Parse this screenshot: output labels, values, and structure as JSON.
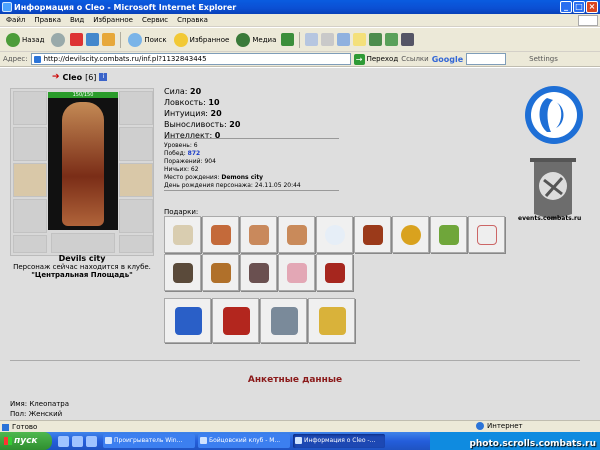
{
  "window": {
    "title": "Информация о Cleo - Microsoft Internet Explorer"
  },
  "menu": [
    "Файл",
    "Правка",
    "Вид",
    "Избранное",
    "Сервис",
    "Справка"
  ],
  "toolbar": {
    "back": "Назад",
    "search": "Поиск",
    "favorites": "Избранное",
    "media": "Медиа"
  },
  "address": {
    "label": "Адрес:",
    "url": "http://devilscity.combats.ru/inf.pl?1132843445",
    "go": "Переход",
    "links": "Ссылки",
    "google": "Google",
    "settings": "Settings"
  },
  "character": {
    "name": "Cleo",
    "level_tag": "[6]",
    "hp": "150/150",
    "clan_city": "Devils city",
    "location_text": "Персонаж сейчас находится в клубе.",
    "location_place": "\"Центральная Площадь\""
  },
  "stats": [
    {
      "label": "Сила:",
      "value": "20"
    },
    {
      "label": "Ловкость:",
      "value": "10"
    },
    {
      "label": "Интуиция:",
      "value": "20"
    },
    {
      "label": "Выносливость:",
      "value": "20"
    },
    {
      "label": "Интеллект:",
      "value": "0"
    }
  ],
  "info": [
    {
      "label": "Уровень:",
      "value": "6"
    },
    {
      "label": "Побед:",
      "value": "872"
    },
    {
      "label": "Поражений:",
      "value": "904"
    },
    {
      "label": "Ничьих:",
      "value": "62"
    },
    {
      "label": "Место рождения:",
      "value": "Demons city"
    },
    {
      "label": "День рождения персонажа:",
      "value": "24.11.05 20:44"
    }
  ],
  "gifts": {
    "label": "Подарки:",
    "row1": [
      "gift-rattle",
      "gift-bear-santa",
      "gift-bear",
      "gift-bear-2",
      "gift-snowflake",
      "gift-rocking-horse",
      "gift-gold-coin",
      "gift-goblin",
      "gift-white-rabbit"
    ],
    "row2": [
      "gift-helmet",
      "gift-broom",
      "gift-dark-creature",
      "gift-pig-wings",
      "gift-present-box"
    ],
    "row3": [
      "gift-tree-card",
      "gift-photo-card",
      "gift-flowers",
      "gift-golden-boxes"
    ]
  },
  "sidebar": {
    "events": "events.combats.ru"
  },
  "questionnaire": {
    "title": "Анкетные данные",
    "name_label": "Имя:",
    "name_value": "Клеопатра",
    "sex_label": "Пол:",
    "sex_value": "Женский"
  },
  "status": {
    "ready": "Готово",
    "zone": "Интернет"
  },
  "taskbar": {
    "start": "пуск",
    "tasks": [
      "Проигрыватель Win...",
      "Бойцовский клуб - М...",
      "Информация о Cleo -..."
    ],
    "watermark": "photo.scrolls.combats.ru"
  },
  "colors": {
    "accent": "#0b4fd3",
    "heading": "#8b1a1a",
    "victory": "#1a3cc7"
  }
}
